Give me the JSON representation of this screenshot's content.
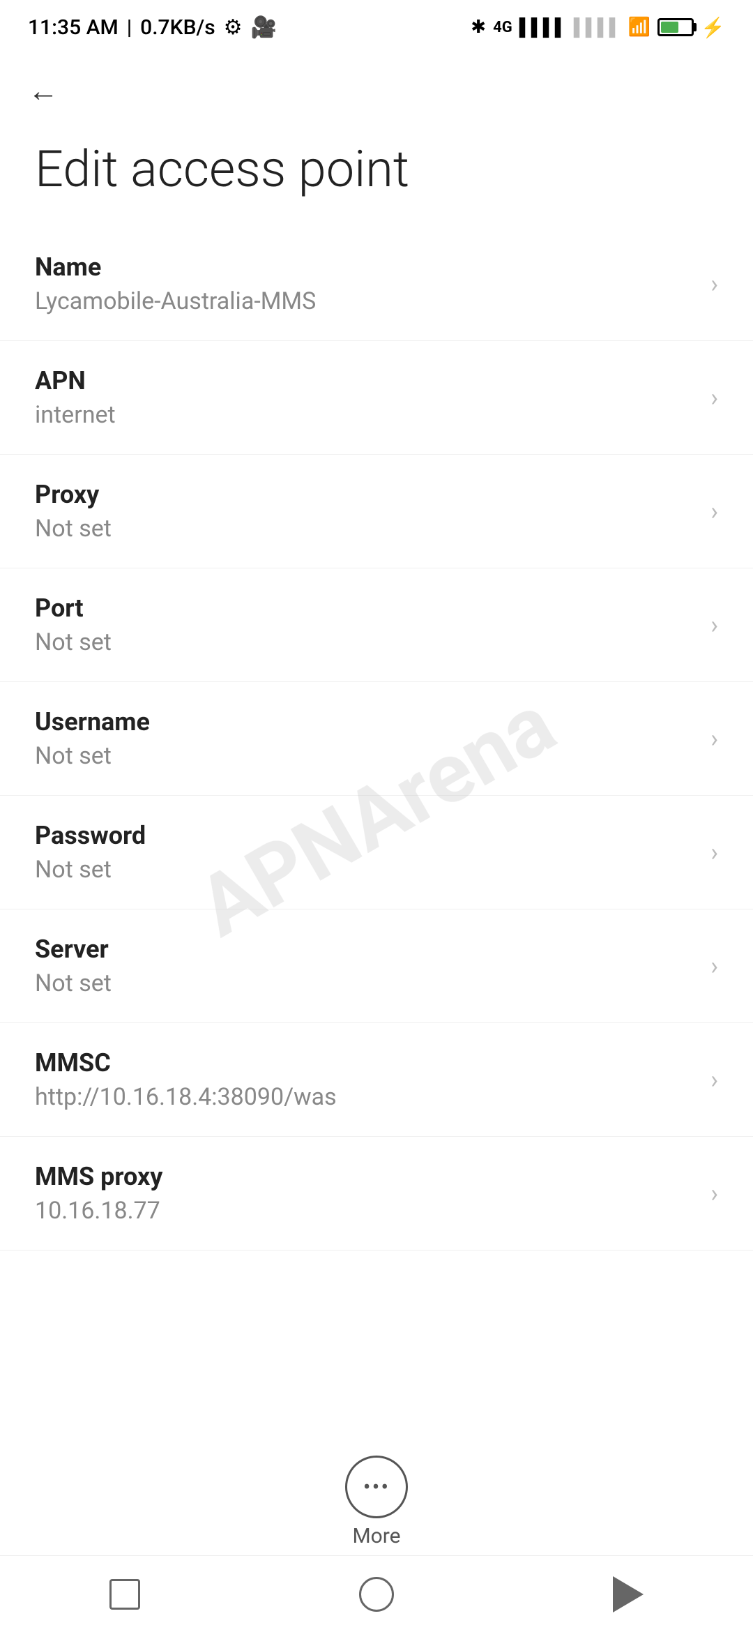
{
  "statusBar": {
    "time": "11:35 AM",
    "network": "0.7KB/s",
    "batteryPercent": "38"
  },
  "nav": {
    "backLabel": "←"
  },
  "page": {
    "title": "Edit access point"
  },
  "settings": [
    {
      "id": "name",
      "label": "Name",
      "value": "Lycamobile-Australia-MMS"
    },
    {
      "id": "apn",
      "label": "APN",
      "value": "internet"
    },
    {
      "id": "proxy",
      "label": "Proxy",
      "value": "Not set"
    },
    {
      "id": "port",
      "label": "Port",
      "value": "Not set"
    },
    {
      "id": "username",
      "label": "Username",
      "value": "Not set"
    },
    {
      "id": "password",
      "label": "Password",
      "value": "Not set"
    },
    {
      "id": "server",
      "label": "Server",
      "value": "Not set"
    },
    {
      "id": "mmsc",
      "label": "MMSC",
      "value": "http://10.16.18.4:38090/was"
    },
    {
      "id": "mms-proxy",
      "label": "MMS proxy",
      "value": "10.16.18.77"
    }
  ],
  "more": {
    "label": "More"
  },
  "watermark": "APNArena"
}
